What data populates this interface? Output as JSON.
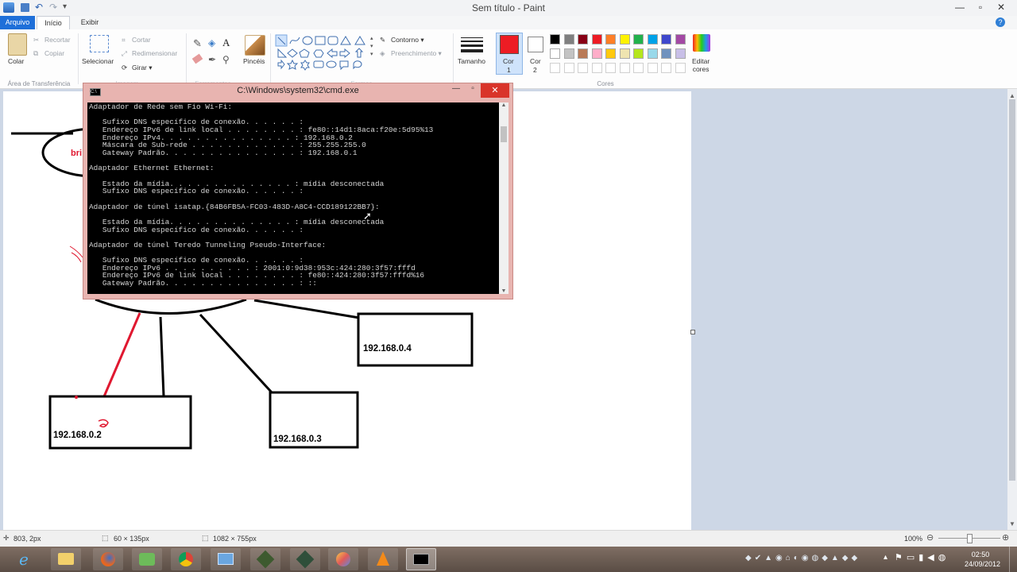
{
  "window": {
    "title": "Sem título - Paint"
  },
  "tabs": {
    "arquivo": "Arquivo",
    "inicio": "Início",
    "exibir": "Exibir"
  },
  "clipboard": {
    "colar": "Colar",
    "recortar": "Recortar",
    "copiar": "Copiar",
    "group": "Área de Transferência"
  },
  "image": {
    "selecionar": "Selecionar",
    "cortar": "Cortar",
    "redimensionar": "Redimensionar",
    "girar": "Girar ▾",
    "group": "Imagem"
  },
  "tools": {
    "group": "Ferramentas"
  },
  "brushes": {
    "pinceis": "Pincéis"
  },
  "shapes": {
    "contorno": "Contorno ▾",
    "preenchimento": "Preenchimento ▾",
    "group": "Formas"
  },
  "size": {
    "tamanho": "Tamanho"
  },
  "colors": {
    "cor1": "Cor",
    "cor1_num": "1",
    "cor2": "Cor",
    "cor2_num": "2",
    "editar": "Editar",
    "editar2": "cores",
    "group": "Cores",
    "color1_hex": "#ed1c24",
    "color2_hex": "#ffffff",
    "palette_row1": [
      "#000000",
      "#7f7f7f",
      "#880015",
      "#ed1c24",
      "#ff7f27",
      "#fff200",
      "#22b14c",
      "#00a2e8",
      "#3f48cc",
      "#a349a4"
    ],
    "palette_row2": [
      "#ffffff",
      "#c3c3c3",
      "#b97a57",
      "#ffaec9",
      "#ffc90e",
      "#efe4b0",
      "#b5e61d",
      "#99d9ea",
      "#7092be",
      "#c8bfe7"
    ]
  },
  "drawing": {
    "labels": [
      "192.168.0.4",
      "192.168.0.2",
      "192.168.0.3"
    ],
    "partial": "bri"
  },
  "cmd": {
    "title": "C:\\Windows\\system32\\cmd.exe",
    "lines": [
      "Adaptador de Rede sem Fio Wi-Fi:",
      "",
      "   Sufixo DNS específico de conexão. . . . . . :",
      "   Endereço IPv6 de link local . . . . . . . . : fe80::14d1:8aca:f20e:5d95%13",
      "   Endereço IPv4. . . . . . . . . . . . . . . : 192.168.0.2",
      "   Máscara de Sub-rede . . . . . . . . . . . . : 255.255.255.0",
      "   Gateway Padrão. . . . . . . . . . . . . . . : 192.168.0.1",
      "",
      "Adaptador Ethernet Ethernet:",
      "",
      "   Estado da mídia. . . . . . . . . . . . . . : mídia desconectada",
      "   Sufixo DNS específico de conexão. . . . . . :",
      "",
      "Adaptador de túnel isatap.{84B6FB5A-FC03-483D-A8C4-CCD189122BB7}:",
      "",
      "   Estado da mídia. . . . . . . . . . . . . . : mídia desconectada",
      "   Sufixo DNS específico de conexão. . . . . . :",
      "",
      "Adaptador de túnel Teredo Tunneling Pseudo-Interface:",
      "",
      "   Sufixo DNS específico de conexão. . . . . . :",
      "   Endereço IPv6 . . . . . . . . . . : 2001:0:9d38:953c:424:280:3f57:fffd",
      "   Endereço IPv6 de link local . . . . . . . . : fe80::424:280:3f57:fffd%16",
      "   Gateway Padrão. . . . . . . . . . . . . . . : ::"
    ]
  },
  "status": {
    "cursor": "803, 2px",
    "selection": "60 × 135px",
    "canvas_size": "1082 × 755px",
    "zoom": "100%"
  },
  "taskbar": {
    "time": "02:50",
    "date": "24/09/2012"
  }
}
